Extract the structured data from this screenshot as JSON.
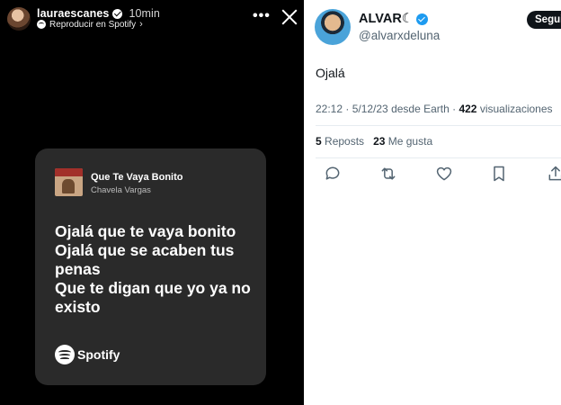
{
  "story": {
    "username": "lauraescanes",
    "time": "10min",
    "subtitle": "Reproducir en Spotify",
    "song": {
      "title": "Que Te Vaya Bonito",
      "artist": "Chavela Vargas"
    },
    "lyrics": [
      "Ojalá que te vaya bonito",
      "Ojalá que se acaben tus penas",
      "Que te digan que yo ya no existo"
    ],
    "brand": "Spotify"
  },
  "tweet": {
    "name": "ALVAR☾",
    "handle": "@alvarxdeluna",
    "follow_label": "Seguir",
    "text": "Ojalá",
    "meta": {
      "datetime": "22:12 · 5/12/23 desde Earth · ",
      "views": "422",
      "views_label": " visualizaciones"
    },
    "stats": {
      "reposts": "5",
      "reposts_label": " Reposts",
      "likes": "23",
      "likes_label": " Me gusta"
    },
    "icons": [
      "reply-icon",
      "repost-icon",
      "like-icon",
      "bookmark-icon",
      "share-icon"
    ]
  }
}
